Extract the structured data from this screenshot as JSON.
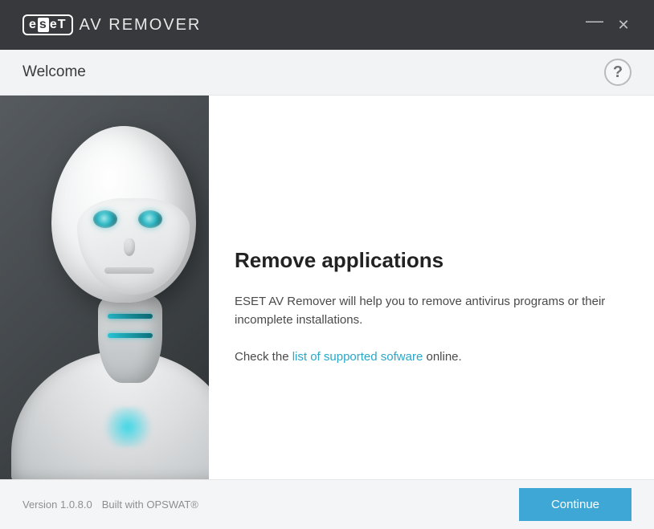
{
  "titlebar": {
    "logo_letters": {
      "e1": "e",
      "s": "s",
      "e2": "e",
      "t": "T"
    },
    "app_title": "AV REMOVER"
  },
  "subheader": {
    "title": "Welcome",
    "help_label": "?"
  },
  "main": {
    "heading": "Remove applications",
    "paragraph1": "ESET AV Remover will help you to remove antivirus programs or their incomplete installations.",
    "check_prefix": "Check the ",
    "link_text": "list of supported sofware",
    "check_suffix": " online."
  },
  "footer": {
    "version": "Version 1.0.8.0",
    "built_with": "Built with OPSWAT®",
    "continue_label": "Continue"
  },
  "icons": {
    "minimize": "—",
    "close": "✕"
  }
}
